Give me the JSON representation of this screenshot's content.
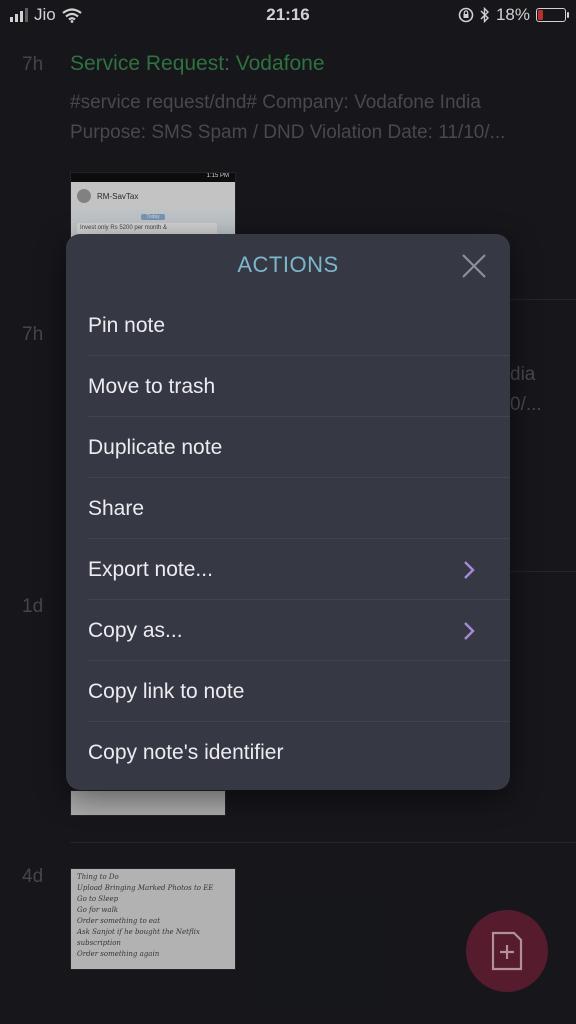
{
  "status_bar": {
    "carrier": "Jio",
    "time": "21:16",
    "battery": "18%"
  },
  "notes": [
    {
      "age": "7h",
      "title": "Service Request: Vodafone",
      "preview_line1": "#service request/dnd# Company: Vodafone India",
      "preview_line2": "Purpose: SMS Spam / DND Violation Date: 11/10/...",
      "thumb_contact": "RM-SavTax",
      "thumb_time": "1:15 PM",
      "thumb_day": "Today",
      "thumb_msg": "Invest only Rs 5200 per month &"
    },
    {
      "age": "7h",
      "preview_fragment1": "dia",
      "preview_fragment2": "0/..."
    },
    {
      "age": "1d"
    },
    {
      "age": "4d",
      "hand_lines": [
        "Thing to Do",
        "Upload Bringing Marked Photos to EE",
        "Go to Sleep",
        "Go for walk",
        "Order something to eat",
        "Ask Sanjot if he bought the Netflix subscription",
        "Order something again"
      ]
    }
  ],
  "actions": {
    "title": "ACTIONS",
    "items": [
      {
        "label": "Pin note"
      },
      {
        "label": "Move to trash"
      },
      {
        "label": "Duplicate note"
      },
      {
        "label": "Share"
      },
      {
        "label": "Export note..."
      },
      {
        "label": "Copy as..."
      },
      {
        "label": "Copy link to note"
      },
      {
        "label": "Copy note's identifier"
      }
    ]
  },
  "colors": {
    "accent_title": "#7cb6cc",
    "chevron": "#a88ad9",
    "note_title": "#3a8a4e",
    "fab": "#6a2137"
  },
  "icons": {
    "close": "close-icon",
    "chevron": "chevron-right-icon",
    "fab": "new-note-icon"
  }
}
